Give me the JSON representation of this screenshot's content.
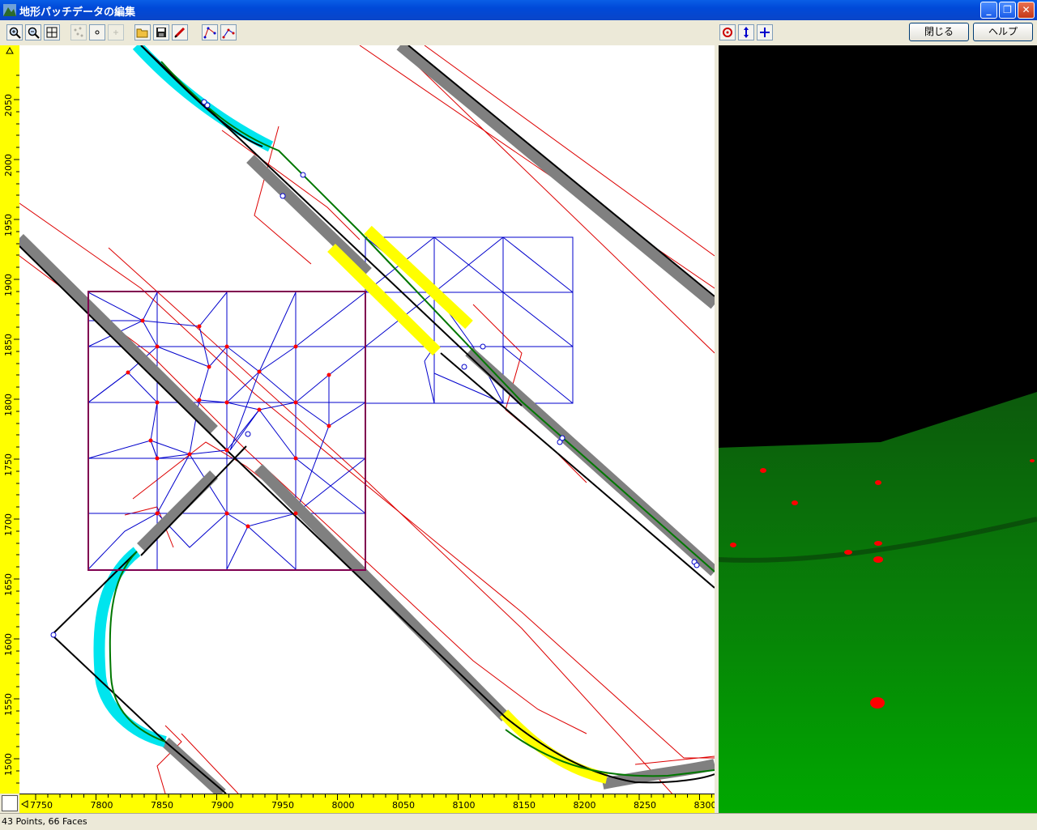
{
  "window": {
    "title": "地形パッチデータの編集",
    "controls": {
      "minimize": "_",
      "restore": "❐",
      "close": "✕"
    }
  },
  "toolbar": {
    "close_label": "閉じる",
    "help_label": "ヘルプ",
    "tools": [
      "zoom-in-icon",
      "zoom-out-icon",
      "fit-view-icon",
      "scatter-points-icon",
      "point-icon",
      "add-point-icon",
      "open-folder-icon",
      "save-disk-icon",
      "edit-pencil-icon",
      "polyline-icon",
      "polyline-alt-icon",
      "rotate-view-icon",
      "move-vertical-icon",
      "move-all-icon"
    ]
  },
  "rulers": {
    "vertical": [
      "2050",
      "2000",
      "1950",
      "1900",
      "1850",
      "1800",
      "1750",
      "1700",
      "1650",
      "1600",
      "1550",
      "1500"
    ],
    "horizontal": [
      "7750",
      "7800",
      "7850",
      "7900",
      "7950",
      "8000",
      "8050",
      "8100",
      "8150",
      "8200",
      "8250",
      "8300"
    ]
  },
  "status": {
    "text": "43 Points, 66 Faces"
  },
  "colors": {
    "ruler": "#ffff00",
    "patch_border": "#800050",
    "mesh_lines": "#0000cc",
    "mesh_points": "#ff0000",
    "track_ballast": "#808080",
    "track_highlight": "#ffff00",
    "curve_highlight": "#00e5ee",
    "terrain_green": "#008800"
  }
}
